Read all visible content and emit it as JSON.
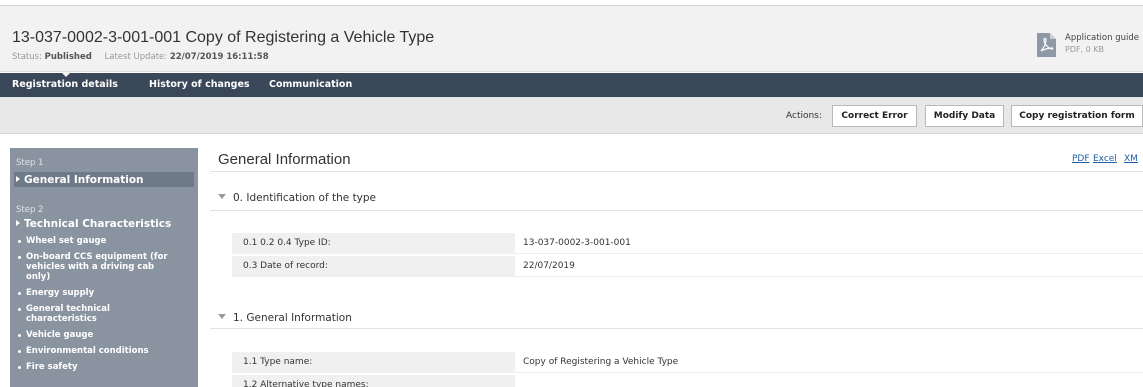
{
  "header": {
    "title": "13-037-0002-3-001-001 Copy of Registering a Vehicle Type",
    "status_label": "Status:",
    "status_value": "Published",
    "update_label": "Latest Update:",
    "update_value": "22/07/2019 16:11:58",
    "guide": {
      "icon": "pdf-icon",
      "title": "Application guide",
      "subtitle": "PDF, 0 KB"
    }
  },
  "tabs": [
    {
      "label": "Registration details",
      "active": true
    },
    {
      "label": "History of changes",
      "active": false
    },
    {
      "label": "Communication",
      "active": false
    }
  ],
  "actions": {
    "label": "Actions:",
    "buttons": [
      "Correct Error",
      "Modify Data",
      "Copy registration form"
    ]
  },
  "sidebar": {
    "steps": [
      {
        "step": "Step 1",
        "title": "General Information",
        "active": true
      },
      {
        "step": "Step 2",
        "title": "Technical Characteristics",
        "items": [
          "Wheel set gauge",
          "On-board CCS equipment (for vehicles with a driving cab only)",
          "Energy supply",
          "General technical characteristics",
          "Vehicle gauge",
          "Environmental conditions",
          "Fire safety"
        ]
      }
    ]
  },
  "main": {
    "title": "General Information",
    "exports": [
      "PDF",
      "Excel",
      "XM"
    ],
    "sections": [
      {
        "title": "0. Identification of the type",
        "rows": [
          {
            "label": "0.1 0.2 0.4 Type ID:",
            "value": "13-037-0002-3-001-001"
          },
          {
            "label": "0.3 Date of record:",
            "value": "22/07/2019"
          }
        ]
      },
      {
        "title": "1. General Information",
        "rows": [
          {
            "label": "1.1 Type name:",
            "value": "Copy of Registering a Vehicle Type"
          },
          {
            "label": "1.2 Alternative type names:",
            "value": ""
          }
        ]
      }
    ]
  },
  "colors": {
    "tabbar": "#3a4758",
    "sidebar": "#8a94a0",
    "sidebar_active": "#6f7a88",
    "link": "#1f5ea8",
    "header_bg": "#f2f2f2",
    "actions_bg": "#e8e8e8"
  }
}
